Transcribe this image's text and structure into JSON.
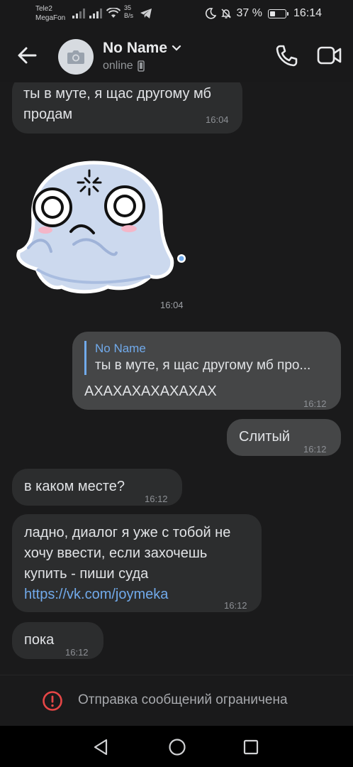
{
  "status_bar": {
    "carrier_1": "Tele2",
    "carrier_2": "MegaFon",
    "speed_value": "35",
    "speed_unit": "B/s",
    "battery_percent": "37 %",
    "battery_level": 0.37,
    "time": "16:14"
  },
  "header": {
    "title": "No Name",
    "subtitle": "online"
  },
  "messages": [
    {
      "id": "m1",
      "direction": "incoming",
      "text_line1": "ты в муте, я щас другому мб",
      "text_line2": "продам",
      "time": "16:04"
    },
    {
      "id": "m2",
      "direction": "incoming",
      "type": "sticker",
      "time": "16:04"
    },
    {
      "id": "m3",
      "direction": "outgoing",
      "reply_to_name": "No Name",
      "reply_to_text": "ты в муте, я щас другому мб про...",
      "text": "АХАХАХАХАХАХАХ",
      "time": "16:12"
    },
    {
      "id": "m4",
      "direction": "outgoing",
      "text": "Слитый",
      "time": "16:12"
    },
    {
      "id": "m5",
      "direction": "incoming",
      "text": "в каком месте?",
      "time": "16:12"
    },
    {
      "id": "m6",
      "direction": "incoming",
      "text_line1": "ладно, диалог я уже с тобой не",
      "text_line2": "хочу ввести, если захочешь",
      "text_line3": "купить - пиши суда",
      "link": "https://vk.com/joymeka",
      "time": "16:12"
    },
    {
      "id": "m7",
      "direction": "incoming",
      "text": "пока",
      "time": "16:12"
    }
  ],
  "restriction": {
    "text": "Отправка сообщений ограничена",
    "icon": "alert-circle-icon",
    "color": "#e64646"
  },
  "colors": {
    "background": "#1a1a1b",
    "incoming_bubble": "#2c2d2e",
    "outgoing_bubble": "#454647",
    "accent": "#71aaeb"
  }
}
